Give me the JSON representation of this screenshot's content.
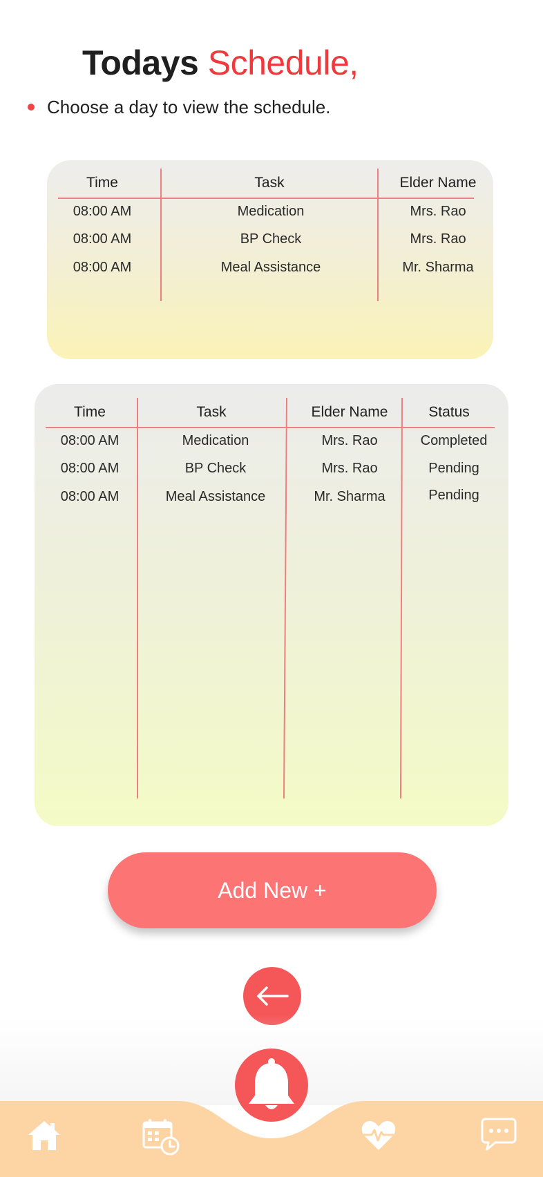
{
  "header": {
    "title_main": "Todays",
    "title_accent": "Schedule,",
    "subtitle": "Choose a day to view the schedule."
  },
  "table1": {
    "columns": [
      "Time",
      "Task",
      "Elder Name"
    ],
    "rows": [
      [
        "08:00 AM",
        "Medication",
        "Mrs. Rao"
      ],
      [
        "08:00 AM",
        "BP Check",
        "Mrs. Rao"
      ],
      [
        "08:00 AM",
        "Meal Assistance",
        "Mr. Sharma"
      ]
    ]
  },
  "table2": {
    "columns": [
      "Time",
      "Task",
      "Elder Name",
      "Status"
    ],
    "rows": [
      [
        "08:00 AM",
        "Medication",
        "Mrs. Rao",
        "Completed"
      ],
      [
        "08:00 AM",
        "BP Check",
        "Mrs. Rao",
        "Pending"
      ],
      [
        "08:00 AM",
        "Meal Assistance",
        "Mr. Sharma",
        "Pending"
      ]
    ]
  },
  "actions": {
    "add_new_label": "Add New +"
  },
  "icons": {
    "back": "arrow-left-icon",
    "bell": "bell-icon",
    "nav": [
      "home-icon",
      "calendar-clock-icon",
      "heart-pulse-icon",
      "chat-icon"
    ]
  },
  "colors": {
    "accent": "#f0393d",
    "button": "#fd7474",
    "circle_button": "#f55759",
    "navbar": "#fdd5a4",
    "divider": "#ee7e80"
  }
}
